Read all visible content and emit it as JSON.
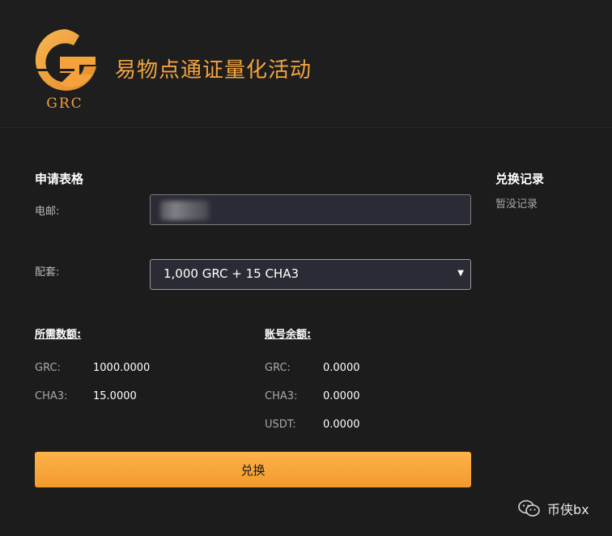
{
  "header": {
    "logo_text": "GRC",
    "title": "易物点通证量化活动"
  },
  "form": {
    "title": "申请表格",
    "email_label": "电邮:",
    "package_label": "配套:",
    "package_selected": "1,000 GRC + 15 CHA3"
  },
  "required": {
    "title": "所需数额:",
    "rows": [
      {
        "key": "GRC:",
        "value": "1000.0000"
      },
      {
        "key": "CHA3:",
        "value": "15.0000"
      }
    ]
  },
  "balance": {
    "title": "账号余额:",
    "rows": [
      {
        "key": "GRC:",
        "value": "0.0000"
      },
      {
        "key": "CHA3:",
        "value": "0.0000"
      },
      {
        "key": "USDT:",
        "value": "0.0000"
      }
    ]
  },
  "submit_label": "兑换",
  "sidebar": {
    "title": "兑换记录",
    "empty_text": "暂没记录"
  },
  "watermark": {
    "text": "币侠bx",
    "icon": "wechat-icon"
  },
  "colors": {
    "accent": "#f3a440",
    "background": "#1c1c1c",
    "input_bg": "#2b2b35"
  }
}
